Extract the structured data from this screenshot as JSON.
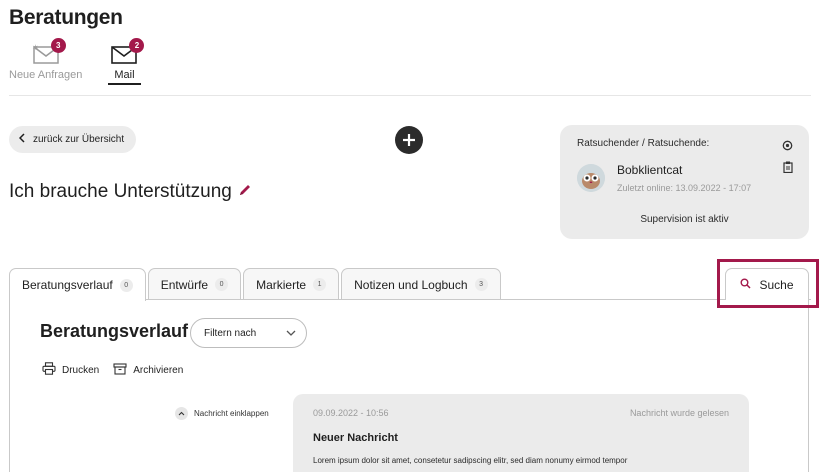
{
  "page_title": "Beratungen",
  "top_tabs": [
    {
      "label": "Neue Anfragen",
      "badge": "3",
      "active": false
    },
    {
      "label": "Mail",
      "badge": "2",
      "active": true
    }
  ],
  "back_button": {
    "label": "zurück zur Übersicht"
  },
  "conversation_title": "Ich brauche Unterstützung",
  "client_card": {
    "heading": "Ratsuchender / Ratsuchende:",
    "name": "Bobklientcat",
    "last_online": "Zuletzt online: 13.09.2022 - 17:07",
    "supervision": "Supervision ist aktiv"
  },
  "tabs": [
    {
      "label": "Beratungsverlauf",
      "count": "0",
      "active": true
    },
    {
      "label": "Entwürfe",
      "count": "0",
      "active": false
    },
    {
      "label": "Markierte",
      "count": "1",
      "active": false
    },
    {
      "label": "Notizen und Logbuch",
      "count": "3",
      "active": false
    }
  ],
  "search_tab": {
    "label": "Suche"
  },
  "panel": {
    "title": "Beratungsverlauf",
    "filter_label": "Filtern nach",
    "print_label": "Drucken",
    "archive_label": "Archivieren",
    "collapse_label": "Nachricht einklappen"
  },
  "message": {
    "date": "09.09.2022 - 10:56",
    "status": "Nachricht wurde gelesen",
    "subject": "Neuer Nachricht",
    "body": "Lorem ipsum dolor sit amet, consetetur sadipscing elitr, sed diam nonumy eirmod tempor"
  },
  "colors": {
    "accent": "#a3194b",
    "card_bg": "#ebebeb",
    "dark": "#2b2b2b"
  }
}
